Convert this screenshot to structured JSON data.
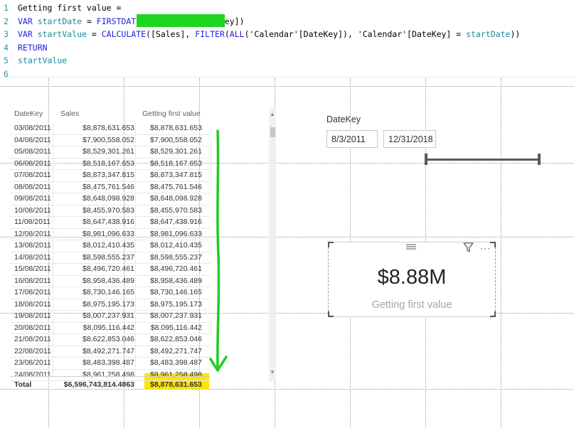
{
  "editor": {
    "lines": [
      {
        "num": "1",
        "tokens": [
          {
            "t": "Getting first value =",
            "c": "def"
          }
        ]
      },
      {
        "num": "2",
        "tokens": [
          {
            "t": "VAR ",
            "c": "kw"
          },
          {
            "t": "startDate",
            "c": "var"
          },
          {
            "t": " = ",
            "c": "def"
          },
          {
            "t": "FIRSTDATE",
            "c": "fn"
          },
          {
            "t": "('Calendar'[DateKey])",
            "c": "def"
          }
        ]
      },
      {
        "num": "3",
        "tokens": [
          {
            "t": "VAR ",
            "c": "kw"
          },
          {
            "t": "startValue",
            "c": "var"
          },
          {
            "t": " = ",
            "c": "def"
          },
          {
            "t": "CALCULATE",
            "c": "fn"
          },
          {
            "t": "([Sales], ",
            "c": "def"
          },
          {
            "t": "FILTER",
            "c": "fn"
          },
          {
            "t": "(",
            "c": "def"
          },
          {
            "t": "ALL",
            "c": "fn"
          },
          {
            "t": "('Calendar'[DateKey]), 'Calendar'[DateKey] = ",
            "c": "def"
          },
          {
            "t": "startDate",
            "c": "var"
          },
          {
            "t": "))",
            "c": "def"
          }
        ]
      },
      {
        "num": "4",
        "tokens": [
          {
            "t": "RETURN",
            "c": "kw"
          }
        ]
      },
      {
        "num": "5",
        "tokens": [
          {
            "t": "startValue",
            "c": "var"
          }
        ]
      },
      {
        "num": "6",
        "tokens": []
      }
    ]
  },
  "table": {
    "headers": {
      "date": "DateKey",
      "sales": "Sales",
      "first": "Getting first value"
    },
    "rows": [
      {
        "date": "03/08/2011",
        "sales": "$8,878,631.653",
        "first": "$8,878,631.653"
      },
      {
        "date": "04/08/2011",
        "sales": "$7,900,558.052",
        "first": "$7,900,558.052"
      },
      {
        "date": "05/08/2011",
        "sales": "$8,529,301.261",
        "first": "$8,529,301.261"
      },
      {
        "date": "06/08/2011",
        "sales": "$8,518,167.653",
        "first": "$8,518,167.653"
      },
      {
        "date": "07/08/2011",
        "sales": "$8,873,347.815",
        "first": "$8,873,347.815"
      },
      {
        "date": "08/08/2011",
        "sales": "$8,475,761.546",
        "first": "$8,475,761.546"
      },
      {
        "date": "09/08/2011",
        "sales": "$8,648,098.928",
        "first": "$8,648,098.928"
      },
      {
        "date": "10/08/2011",
        "sales": "$8,455,970.583",
        "first": "$8,455,970.583"
      },
      {
        "date": "11/08/2011",
        "sales": "$8,647,438.916",
        "first": "$8,647,438.916"
      },
      {
        "date": "12/08/2011",
        "sales": "$8,981,096.633",
        "first": "$8,981,096.633"
      },
      {
        "date": "13/08/2011",
        "sales": "$8,012,410.435",
        "first": "$8,012,410.435"
      },
      {
        "date": "14/08/2011",
        "sales": "$8,598,555.237",
        "first": "$8,598,555.237"
      },
      {
        "date": "15/08/2011",
        "sales": "$8,496,720.461",
        "first": "$8,496,720.461"
      },
      {
        "date": "16/08/2011",
        "sales": "$8,958,436.489",
        "first": "$8,958,436.489"
      },
      {
        "date": "17/08/2011",
        "sales": "$8,730,146.165",
        "first": "$8,730,146.165"
      },
      {
        "date": "18/08/2011",
        "sales": "$8,975,195.173",
        "first": "$8,975,195.173"
      },
      {
        "date": "19/08/2011",
        "sales": "$8,007,237.931",
        "first": "$8,007,237.931"
      },
      {
        "date": "20/08/2011",
        "sales": "$8,095,116.442",
        "first": "$8,095,116.442"
      },
      {
        "date": "21/08/2011",
        "sales": "$8,622,853.046",
        "first": "$8,622,853.046"
      },
      {
        "date": "22/08/2011",
        "sales": "$8,492,271.747",
        "first": "$8,492,271.747"
      },
      {
        "date": "23/08/2011",
        "sales": "$8,483,398.487",
        "first": "$8,483,398.487"
      },
      {
        "date": "24/08/2011",
        "sales": "$8,961,258.498",
        "first": "$8,961,258.498"
      }
    ],
    "total": {
      "label": "Total",
      "sales": "$6,596,743,814.4863",
      "first": "$8,878,631.653"
    }
  },
  "slicer": {
    "title": "DateKey",
    "start": "8/3/2011",
    "end": "12/31/2018"
  },
  "card": {
    "value": "$8.88M",
    "label": "Getting first value",
    "more_glyph": "···"
  },
  "colors": {
    "highlight_green": "#1fd41f",
    "highlight_yellow": "#ffe600",
    "arrow_green": "#22cc22"
  },
  "icons": [
    "drag-handle-icon",
    "filter-icon",
    "more-options-icon",
    "scroll-up-icon",
    "scroll-down-icon",
    "green-arrow-annotation"
  ]
}
